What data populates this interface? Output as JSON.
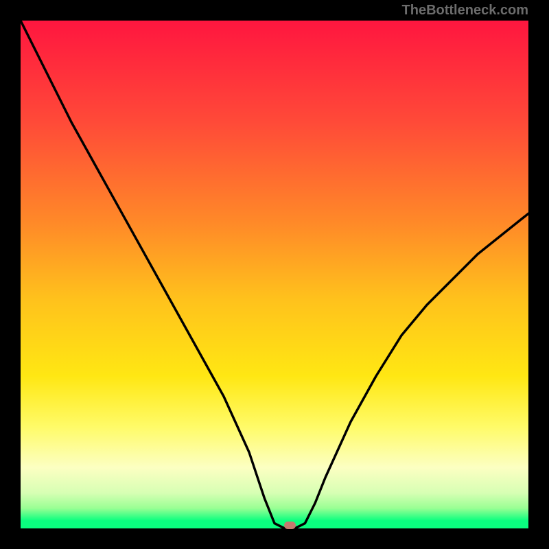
{
  "attribution": "TheBottleneck.com",
  "colors": {
    "frame": "#000000",
    "gradient_stops": [
      "#ff163f",
      "#ff4a38",
      "#ff8a28",
      "#ffc21c",
      "#ffe713",
      "#fffb68",
      "#fcffc2",
      "#d7ffb4",
      "#9aff94",
      "#0aff7f"
    ],
    "curve": "#000000",
    "marker": "#c47a6f"
  },
  "chart_data": {
    "type": "line",
    "title": "",
    "xlabel": "",
    "ylabel": "",
    "xlim": [
      0,
      100
    ],
    "ylim": [
      0,
      100
    ],
    "grid": false,
    "legend": false,
    "series": [
      {
        "name": "bottleneck-curve",
        "x": [
          0,
          5,
          10,
          15,
          20,
          25,
          30,
          35,
          40,
          45,
          48,
          50,
          52,
          54,
          56,
          58,
          60,
          65,
          70,
          75,
          80,
          85,
          90,
          95,
          100
        ],
        "values": [
          100,
          90,
          80,
          71,
          62,
          53,
          44,
          35,
          26,
          15,
          6,
          1,
          0,
          0,
          1,
          5,
          10,
          21,
          30,
          38,
          44,
          49,
          54,
          58,
          62
        ]
      }
    ],
    "marker": {
      "x": 53,
      "y": 0
    },
    "background_metric_gradient": {
      "orientation": "vertical",
      "top_value": 100,
      "bottom_value": 0,
      "description": "color encodes bottleneck severity; red=high, green=optimal"
    }
  }
}
